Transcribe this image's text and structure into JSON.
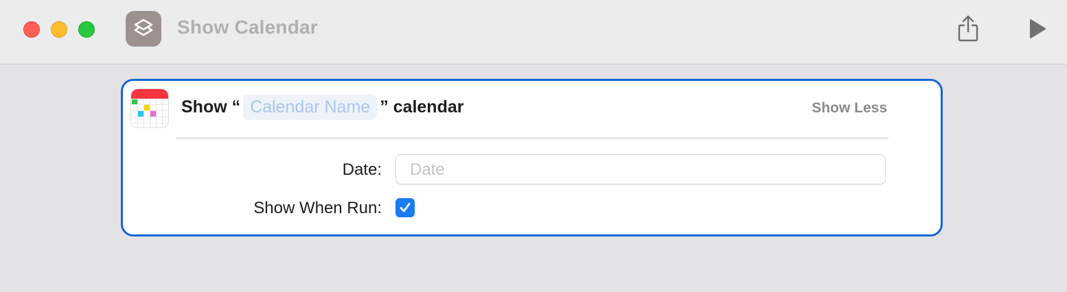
{
  "window": {
    "title": "Show Calendar",
    "traffic_lights": [
      "close",
      "minimize",
      "zoom"
    ],
    "app_icon": "shortcuts-stack-icon",
    "toolbar": {
      "share_icon": "share-icon",
      "run_icon": "play-icon"
    }
  },
  "action": {
    "icon": "calendar-app-icon",
    "prefix": "Show “",
    "parameter_placeholder": "Calendar Name",
    "suffix": "” calendar",
    "toggle_label": "Show Less",
    "params": {
      "date_label": "Date:",
      "date_placeholder": "Date",
      "show_when_run_label": "Show When Run:",
      "show_when_run_checked": true
    }
  },
  "colors": {
    "accent": "#1466d6",
    "checkbox": "#1a7cf5",
    "token_text": "#a9c6ee",
    "token_bg": "#eef3fa",
    "app_icon_bg": "#9c918d"
  }
}
